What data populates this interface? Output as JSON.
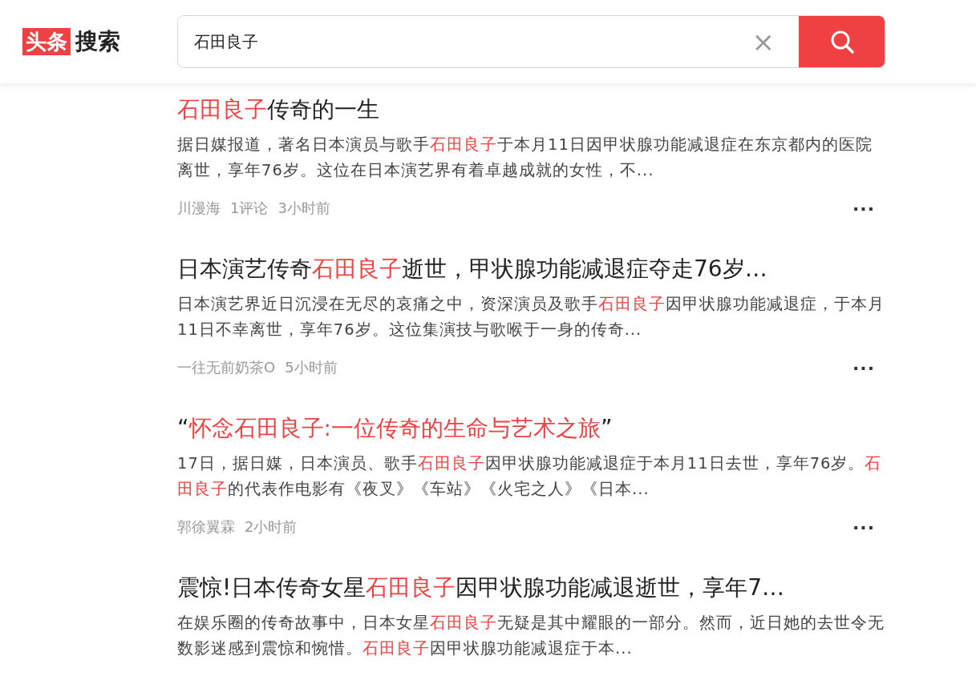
{
  "header": {
    "logo": {
      "badge": "头条",
      "text": "搜索"
    },
    "search": {
      "value": "石田良子",
      "clear": "×"
    }
  },
  "results": [
    {
      "title": [
        {
          "text": "石田良子",
          "highlight": true
        },
        {
          "text": "传奇的一生",
          "highlight": false
        }
      ],
      "snippet": [
        {
          "text": "据日媒报道，著名日本演员与歌手",
          "highlight": false
        },
        {
          "text": "石田良子",
          "highlight": true
        },
        {
          "text": "于本月11日因甲状腺功能减退症在东京都内的医院离世，享年76岁。这位在日本演艺界有着卓越成就的女性，不...",
          "highlight": false
        }
      ],
      "meta": [
        "川漫海",
        "1评论",
        "3小时前"
      ],
      "more": "···"
    },
    {
      "title": [
        {
          "text": "日本演艺传奇",
          "highlight": false
        },
        {
          "text": "石田良子",
          "highlight": true
        },
        {
          "text": "逝世，甲状腺功能减退症夺走76岁…",
          "highlight": false
        }
      ],
      "snippet": [
        {
          "text": "日本演艺界近日沉浸在无尽的哀痛之中，资深演员及歌手",
          "highlight": false
        },
        {
          "text": "石田良子",
          "highlight": true
        },
        {
          "text": "因甲状腺功能减退症，于本月11日不幸离世，享年76岁。这位集演技与歌喉于一身的传奇...",
          "highlight": false
        }
      ],
      "meta": [
        "一往无前奶茶O",
        "5小时前"
      ],
      "more": "···"
    },
    {
      "title": [
        {
          "text": "“",
          "highlight": false
        },
        {
          "text": "怀念石田良子:一位传奇的生命与艺术之旅",
          "highlight": true
        },
        {
          "text": "”",
          "highlight": false
        }
      ],
      "snippet": [
        {
          "text": "17日，据日媒，日本演员、歌手",
          "highlight": false
        },
        {
          "text": "石田良子",
          "highlight": true
        },
        {
          "text": "因甲状腺功能减退症于本月11日去世，享年76岁。",
          "highlight": false
        },
        {
          "text": "石田良子",
          "highlight": true
        },
        {
          "text": "的代表作电影有《夜叉》《车站》《火宅之人》《日本...",
          "highlight": false
        }
      ],
      "meta": [
        "郭徐翼霖",
        "2小时前"
      ],
      "more": "···"
    },
    {
      "title": [
        {
          "text": "震惊!日本传奇女星",
          "highlight": false
        },
        {
          "text": "石田良子",
          "highlight": true
        },
        {
          "text": "因甲状腺功能减退逝世，享年7…",
          "highlight": false
        }
      ],
      "snippet": [
        {
          "text": "在娱乐圈的传奇故事中，日本女星",
          "highlight": false
        },
        {
          "text": "石田良子",
          "highlight": true
        },
        {
          "text": "无疑是其中耀眼的一部分。然而，近日她的去世令无数影迷感到震惊和惋惜。",
          "highlight": false
        },
        {
          "text": "石田良子",
          "highlight": true
        },
        {
          "text": "因甲状腺功能减退症于本...",
          "highlight": false
        }
      ]
    }
  ]
}
